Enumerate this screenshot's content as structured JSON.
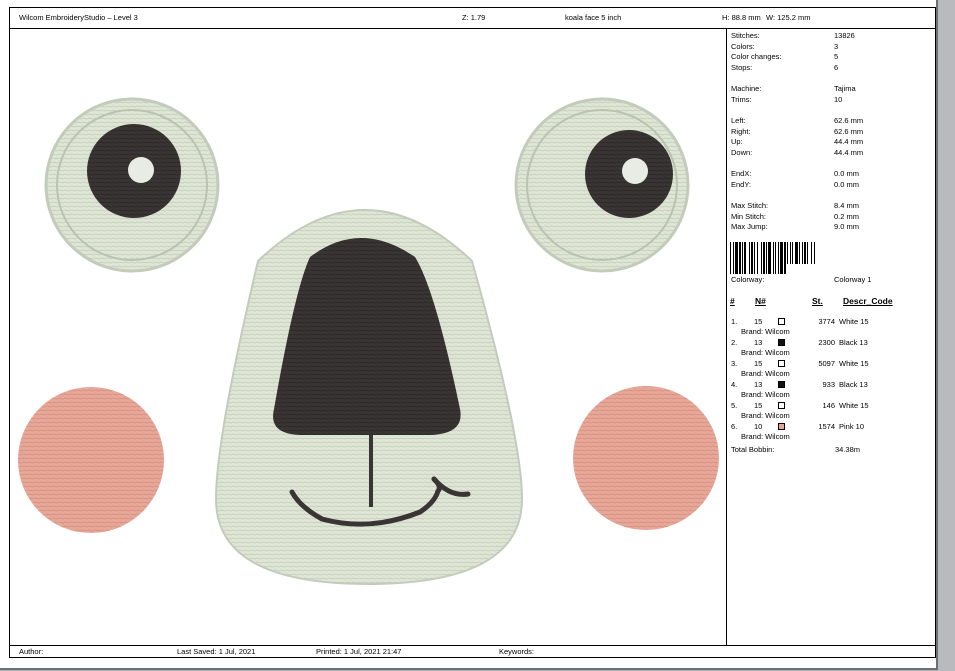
{
  "header": {
    "title": "Wilcom EmbroideryStudio – Level 3",
    "zoom": "Z: 1.79",
    "design_name": "koala face 5 inch",
    "height": "H: 88.8 mm",
    "width": "W: 125.2 mm"
  },
  "stats": [
    {
      "label": "Stitches:",
      "value": "13826"
    },
    {
      "label": "Colors:",
      "value": "3"
    },
    {
      "label": "Color changes:",
      "value": "5"
    },
    {
      "label": "Stops:",
      "value": "6"
    },
    {
      "label": "Machine:",
      "value": "Tajima"
    },
    {
      "label": "Trims:",
      "value": "10"
    },
    {
      "label": "Left:",
      "value": "62.6 mm"
    },
    {
      "label": "Right:",
      "value": "62.6 mm"
    },
    {
      "label": "Up:",
      "value": "44.4 mm"
    },
    {
      "label": "Down:",
      "value": "44.4 mm"
    },
    {
      "label": "EndX:",
      "value": "0.0 mm"
    },
    {
      "label": "EndY:",
      "value": "0.0 mm"
    },
    {
      "label": "Max Stitch:",
      "value": "8.4 mm"
    },
    {
      "label": "Min Stitch:",
      "value": "0.2 mm"
    },
    {
      "label": "Max Jump:",
      "value": "9.0 mm"
    }
  ],
  "colorway": {
    "label": "Colorway:",
    "value": "Colorway 1"
  },
  "color_table": {
    "headers": {
      "num": "#",
      "n": "N#",
      "st": "St.",
      "descr": "Descr_Code"
    },
    "rows": [
      {
        "idx": "1.",
        "n": "15",
        "swatch": "#ffffff",
        "st": "3774",
        "descr": "White 15",
        "brand": "Brand: Wilcom"
      },
      {
        "idx": "2.",
        "n": "13",
        "swatch": "#111111",
        "st": "2300",
        "descr": "Black 13",
        "brand": "Brand: Wilcom"
      },
      {
        "idx": "3.",
        "n": "15",
        "swatch": "#ffffff",
        "st": "5097",
        "descr": "White 15",
        "brand": "Brand: Wilcom"
      },
      {
        "idx": "4.",
        "n": "13",
        "swatch": "#111111",
        "st": "933",
        "descr": "Black 13",
        "brand": "Brand: Wilcom"
      },
      {
        "idx": "5.",
        "n": "15",
        "swatch": "#ffffff",
        "st": "146",
        "descr": "White 15",
        "brand": "Brand: Wilcom"
      },
      {
        "idx": "6.",
        "n": "10",
        "swatch": "#e8a49b",
        "st": "1574",
        "descr": "Pink 10",
        "brand": "Brand: Wilcom"
      }
    ],
    "total_label": "Total Bobbin:",
    "total_value": "34.38m"
  },
  "footer": {
    "author": "Author:",
    "last_saved": "Last Saved:  1 Jul, 2021",
    "printed": "Printed:  1 Jul, 2021 21:47",
    "keywords": "Keywords:"
  },
  "colors": {
    "thread_white": "#dfe6d6",
    "thread_black": "#3a3534",
    "thread_pink": "#e7a89a",
    "accent_frame": "#000000"
  }
}
